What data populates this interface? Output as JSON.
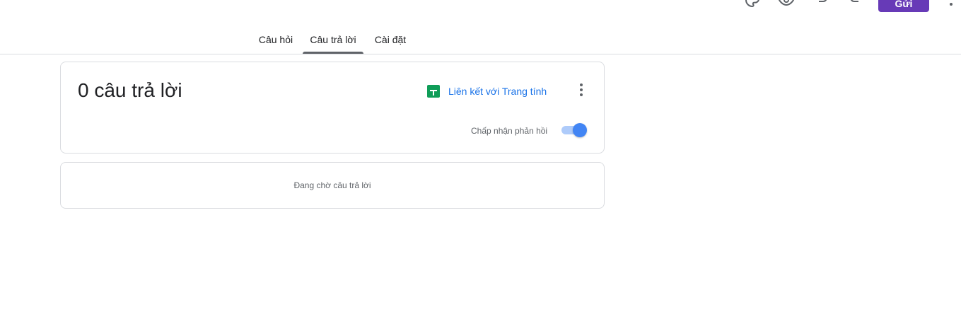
{
  "header": {
    "send_label": "Gửi",
    "icons": [
      "palette-icon",
      "preview-icon",
      "undo-icon",
      "redo-icon",
      "more-vert-icon"
    ]
  },
  "tabs": [
    {
      "label": "Câu hỏi",
      "active": false
    },
    {
      "label": "Câu trả lời",
      "active": true
    },
    {
      "label": "Cài đặt",
      "active": false
    }
  ],
  "summary": {
    "count_text": "0 câu trả lời",
    "link_sheets_label": "Liên kết với Trang tính",
    "accepting_label": "Chấp nhận phản hồi",
    "accepting_on": true
  },
  "empty_state": {
    "message": "Đang chờ câu trả lời"
  },
  "colors": {
    "accent": "#673ab7",
    "link": "#1a73e8",
    "sheets_green": "#0f9d58",
    "toggle_on": "#4285f4"
  }
}
